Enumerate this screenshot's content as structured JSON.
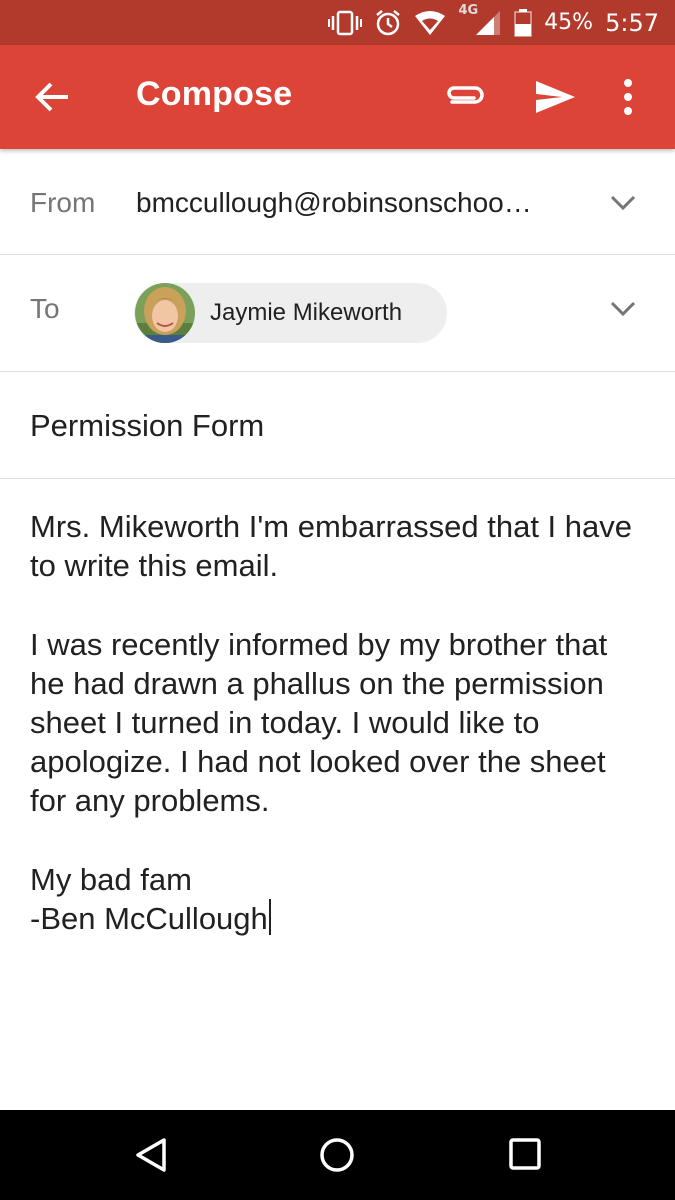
{
  "status_bar": {
    "network": "4G",
    "battery": "45%",
    "time": "5:57",
    "icons": [
      "vibrate-icon",
      "alarm-icon",
      "wifi-icon",
      "signal-icon",
      "battery-icon"
    ]
  },
  "app_bar": {
    "title": "Compose",
    "background": "#db4437",
    "icons": [
      "back-arrow-icon",
      "attach-icon",
      "send-icon",
      "more-vert-icon"
    ]
  },
  "from": {
    "label": "From",
    "value": "bmccullough@robinsonschoo…"
  },
  "to": {
    "label": "To",
    "recipient": "Jaymie Mikeworth"
  },
  "subject": "Permission Form",
  "body": {
    "paragraphs": [
      "Mrs. Mikeworth I'm embarrassed that I have to write this email.",
      "I was recently informed by my brother that he had drawn a phallus on the permission sheet I turned in today. I would like to apologize. I had not looked over the sheet for any problems.",
      "My bad fam",
      "-Ben McCullough"
    ]
  },
  "nav_bar": {
    "icons": [
      "back-triangle-icon",
      "home-circle-icon",
      "recents-square-icon"
    ]
  }
}
